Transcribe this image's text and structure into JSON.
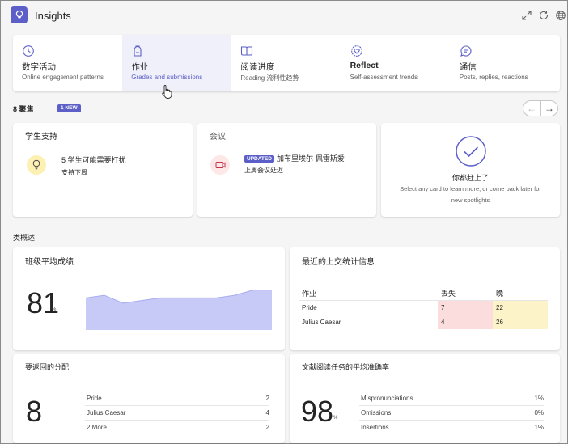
{
  "app": {
    "title": "Insights",
    "accent": "#5b5fc7",
    "toolbar_icons": [
      "expand-icon",
      "refresh-icon",
      "globe-icon"
    ]
  },
  "tabs": [
    {
      "title": "数字活动",
      "subtitle": "Online engagement patterns",
      "icon": "clock-icon",
      "active": false
    },
    {
      "title": "作业",
      "subtitle": "Grades and submissions",
      "icon": "backpack-icon",
      "active": true
    },
    {
      "title": "阅读进度",
      "subtitle": "Reading 流利性趋势",
      "icon": "book-icon",
      "active": false
    },
    {
      "title": "Reflect",
      "subtitle": "Self-assessment trends",
      "icon": "heart-badge-icon",
      "active": false
    },
    {
      "title": "通信",
      "subtitle": "Posts, replies, reactions",
      "icon": "chat-icon",
      "active": false
    }
  ],
  "spotlights": {
    "heading": "8 聚焦",
    "badge": "1 NEW",
    "cards": [
      {
        "title": "学生支持",
        "line1": "5 学生可能需要打扰",
        "line2": "支持下周",
        "icon": "lightbulb-icon"
      },
      {
        "title": "会议",
        "badge": "UPDATED",
        "line1": "加布里埃尔·佩雷斯爱",
        "line2": "上周会议延迟",
        "icon": "meeting-icon"
      },
      {
        "title": "你都赶上了",
        "line1": "Select any card to learn more, or come back later for",
        "line2": "new spotlights",
        "icon": "check-icon"
      }
    ]
  },
  "overview": {
    "heading": "类概述",
    "avg_grade": {
      "title": "班级平均成绩",
      "value": "81",
      "unit": "%",
      "chart_data": {
        "type": "area",
        "values": [
          81,
          82,
          79,
          80,
          81,
          81,
          81,
          81,
          82,
          84,
          84
        ],
        "ylim": [
          0,
          100
        ],
        "color": "#c7c9f7"
      }
    },
    "recent_submissions": {
      "title": "最近的上交统计信息",
      "columns": [
        "作业",
        "丢失",
        "晚"
      ],
      "rows": [
        {
          "name": "Pride",
          "missing": "7",
          "late": "22"
        },
        {
          "name": "Julius Caesar",
          "missing": "4",
          "late": "26"
        }
      ],
      "missing_color": "#fbdddd",
      "late_color": "#fdf3c8"
    },
    "returned_distribution": {
      "title": "要返回的分配",
      "value": "8",
      "items": [
        {
          "label": "Pride",
          "value": "2"
        },
        {
          "label": "Julius Caesar",
          "value": "4"
        },
        {
          "label": "2 More",
          "value": "2"
        }
      ]
    },
    "reading_accuracy": {
      "title": "文献阅读任务的平均准确率",
      "value": "98",
      "unit": "%",
      "items": [
        {
          "label": "Mispronunciations",
          "value": "1%"
        },
        {
          "label": "Omissions",
          "value": "0%"
        },
        {
          "label": "Insertions",
          "value": "1%"
        }
      ]
    }
  }
}
